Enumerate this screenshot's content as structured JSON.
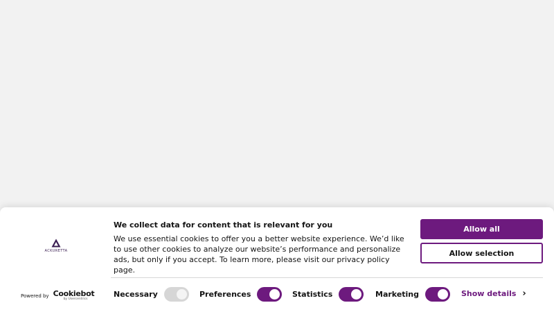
{
  "colors": {
    "accent": "#6d1a7e",
    "background": "#f2f2f2",
    "banner": "#ffffff",
    "disabled_toggle": "#d6d6d6"
  },
  "logo": {
    "text": "ACKURETTA",
    "icon": "triangle-logo-icon"
  },
  "banner": {
    "title": "We collect data for content that is relevant for you",
    "body": "We use essential cookies to offer you a better website experience. We’d like to use other cookies to analyze our website’s performance and personalize ads, but only if you accept. To learn more, please visit our privacy policy page."
  },
  "buttons": {
    "allow_all": "Allow all",
    "allow_selection": "Allow selection"
  },
  "footer": {
    "powered_by": "Powered by",
    "cookiebot": "Cookiebot",
    "cookiebot_sub": "by Usercentrics"
  },
  "toggles": [
    {
      "label": "Necessary",
      "checked": true,
      "disabled": true
    },
    {
      "label": "Preferences",
      "checked": true,
      "disabled": false
    },
    {
      "label": "Statistics",
      "checked": true,
      "disabled": false
    },
    {
      "label": "Marketing",
      "checked": true,
      "disabled": false
    }
  ],
  "show_details": {
    "label": "Show details",
    "icon": "chevron-right-icon"
  }
}
